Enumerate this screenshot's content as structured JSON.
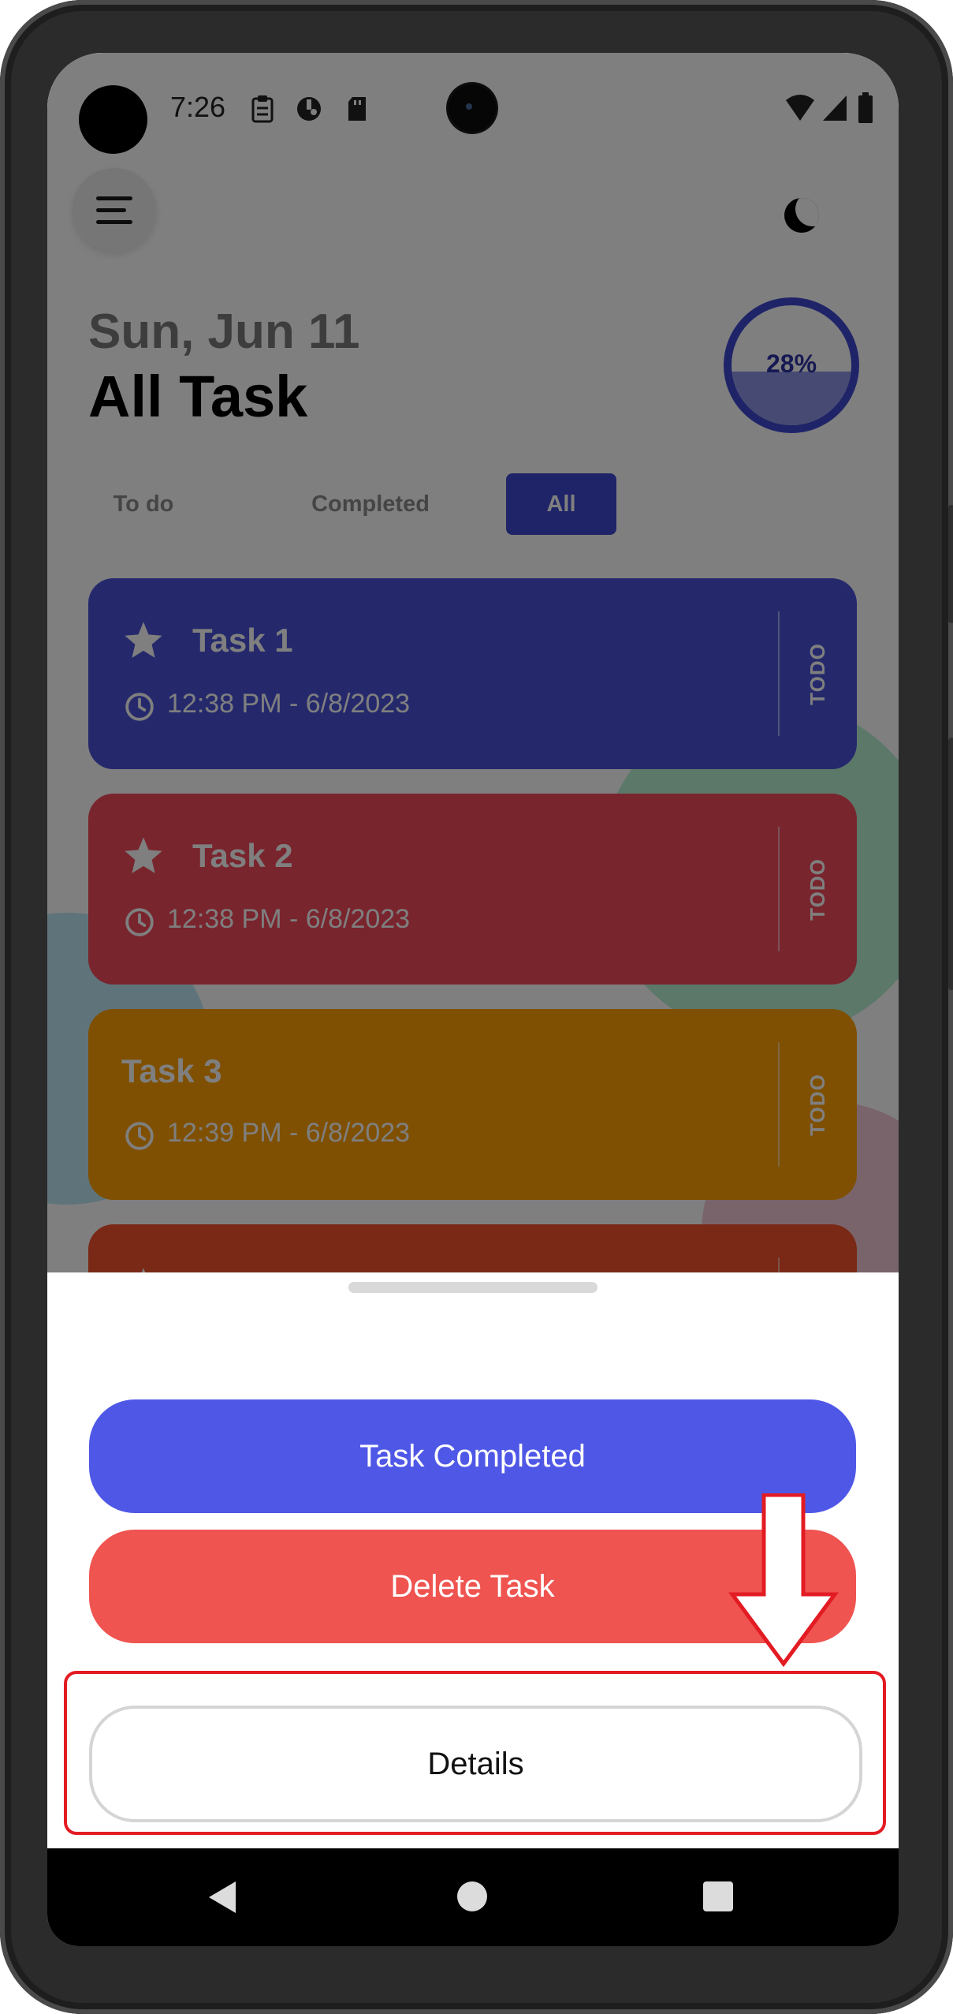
{
  "status_bar": {
    "time": "7:26"
  },
  "header": {
    "date": "Sun, Jun 11",
    "title": "All Task",
    "progress": {
      "label": "28%",
      "value": 0.28
    }
  },
  "filters": [
    {
      "label": "To do",
      "active": false
    },
    {
      "label": "Completed",
      "active": false
    },
    {
      "label": "All",
      "active": true
    }
  ],
  "tasks": [
    {
      "name": "Task 1",
      "time": "12:38 PM - 6/8/2023",
      "status": "TODO",
      "starred": true,
      "color": "#4a52d9"
    },
    {
      "name": "Task 2",
      "time": "12:38 PM - 6/8/2023",
      "status": "TODO",
      "starred": true,
      "color": "#f24a5d"
    },
    {
      "name": "Task 3",
      "time": "12:39 PM - 6/8/2023",
      "status": "TODO",
      "starred": false,
      "color": "#fea003"
    },
    {
      "starred": true,
      "color": "#f2522b"
    }
  ],
  "sheet": {
    "complete_label": "Task Completed",
    "delete_label": "Delete Task",
    "details_label": "Details"
  },
  "colors": {
    "accent": "#3f48d0",
    "complete_button": "#4f58e6",
    "delete_button": "#ef5450",
    "highlight": "#e31b23"
  }
}
